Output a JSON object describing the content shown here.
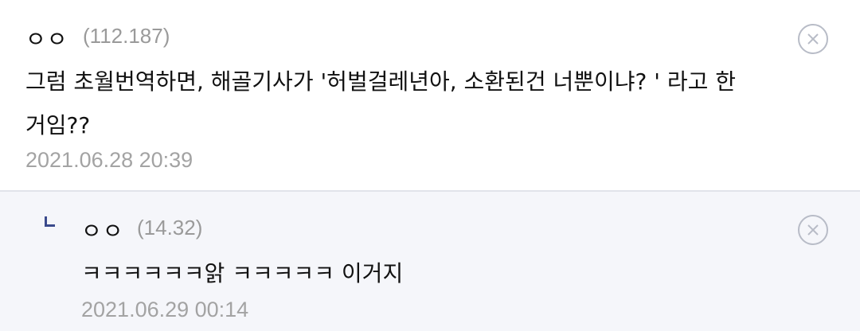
{
  "comments": [
    {
      "nickname": "ㅇㅇ",
      "ip": "(112.187)",
      "text_line1": "그럼 초월번역하면, 해골기사가 '허벌걸레년아, 소환된건 너뿐이냐? ' 라고 한",
      "text_line2": "거임??",
      "date": "2021.06.28 20:39",
      "delete_icon": "close-circle-icon"
    },
    {
      "reply_icon": "reply-arrow-icon",
      "nickname": "ㅇㅇ",
      "ip": "(14.32)",
      "text_line1": "ㅋㅋㅋㅋㅋㅋ앍 ㅋㅋㅋㅋㅋ 이거지",
      "date": "2021.06.29 00:14",
      "delete_icon": "close-circle-icon"
    }
  ],
  "colors": {
    "reply_background": "#f5f6fa",
    "reply_mark": "#3b4a8c",
    "meta_text": "#9a9a9a"
  }
}
